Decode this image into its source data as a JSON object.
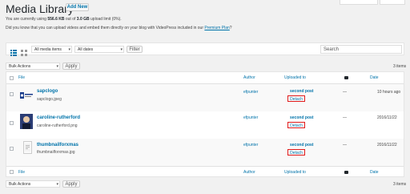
{
  "header": {
    "title": "Media Library",
    "add_new": "Add New",
    "usage_prefix": "You are currently using",
    "usage_used": "556.6 KB",
    "usage_mid": "out of",
    "usage_limit": "3.0 GB",
    "usage_suffix": "upload limit (0%).",
    "promo_text": "Did you know that you can upload videos and embed them directly on your blog with VideoPress included in our",
    "promo_link": "Premium Plan",
    "promo_end": "?"
  },
  "filters": {
    "media_type": "All media items",
    "dates": "All dates",
    "filter_button": "Filter",
    "search_placeholder": "Search"
  },
  "bulk": {
    "top_select": "Bulk Actions",
    "bottom_select": "Bulk Actions",
    "apply": "Apply",
    "items_count": "3 items"
  },
  "table": {
    "columns": {
      "file": "File",
      "author": "Author",
      "uploaded_to": "Uploaded to",
      "date": "Date"
    },
    "rows": [
      {
        "title": "sapclogo",
        "filename": "sapclogo.jpeg",
        "author": "efpunter",
        "uploaded_to": "second post",
        "detach": "Detach",
        "comments": "—",
        "date": "10 hours ago"
      },
      {
        "title": "caroline-rutherford",
        "filename": "caroline-rutherford.png",
        "author": "efpunter",
        "uploaded_to": "second post",
        "detach": "Detach",
        "comments": "—",
        "date": "2016/11/22"
      },
      {
        "title": "thumbnailforxmas",
        "filename": "thumbnailforxmas.jpg",
        "author": "efpunter",
        "uploaded_to": "second post",
        "detach": "Detach",
        "comments": "—",
        "date": "2016/11/22"
      }
    ]
  },
  "icons": {
    "list_view": "list-view-icon",
    "grid_view": "grid-view-icon",
    "comment": "comment-bubble-icon"
  }
}
